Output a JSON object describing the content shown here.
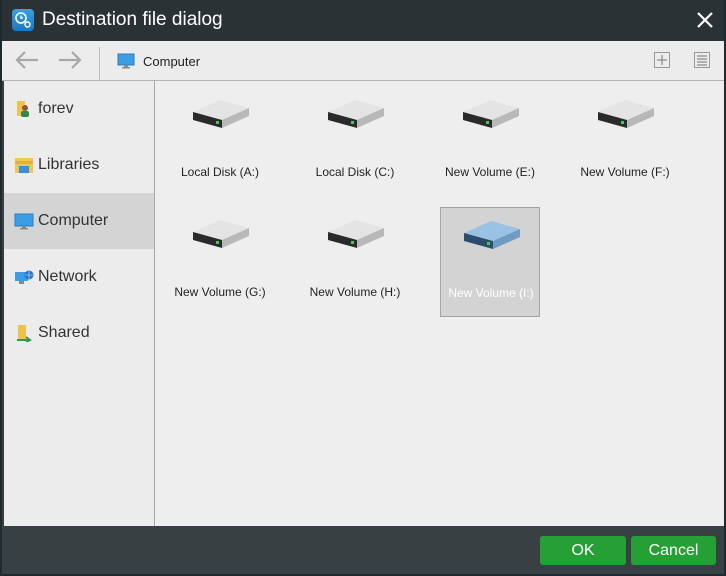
{
  "window": {
    "title": "Destination file dialog",
    "app_icon": "backup-clock-icon",
    "close_icon": "close-icon"
  },
  "toolbar": {
    "back_icon": "arrow-left-icon",
    "forward_icon": "arrow-right-icon",
    "breadcrumb": "Computer",
    "breadcrumb_icon": "monitor-icon",
    "new_folder_icon": "plus-box-icon",
    "view_icon": "list-view-icon"
  },
  "sidebar": {
    "items": [
      {
        "label": "forev",
        "icon": "user-folder-icon",
        "active": false
      },
      {
        "label": "Libraries",
        "icon": "libraries-icon",
        "active": false
      },
      {
        "label": "Computer",
        "icon": "monitor-icon",
        "active": true
      },
      {
        "label": "Network",
        "icon": "network-icon",
        "active": false
      },
      {
        "label": "Shared",
        "icon": "shared-folder-icon",
        "active": false
      }
    ]
  },
  "drives": [
    {
      "label": "Local Disk (A:)",
      "selected": false
    },
    {
      "label": "Local Disk (C:)",
      "selected": false
    },
    {
      "label": "New Volume (E:)",
      "selected": false
    },
    {
      "label": "New Volume (F:)",
      "selected": false
    },
    {
      "label": "New Volume (G:)",
      "selected": false
    },
    {
      "label": "New Volume (H:)",
      "selected": false
    },
    {
      "label": "New Volume (I:)",
      "selected": true
    }
  ],
  "footer": {
    "ok_label": "OK",
    "cancel_label": "Cancel"
  },
  "colors": {
    "title_bar": "#2b3235",
    "accent_button": "#24a034",
    "selection": "#d3d3d3"
  }
}
